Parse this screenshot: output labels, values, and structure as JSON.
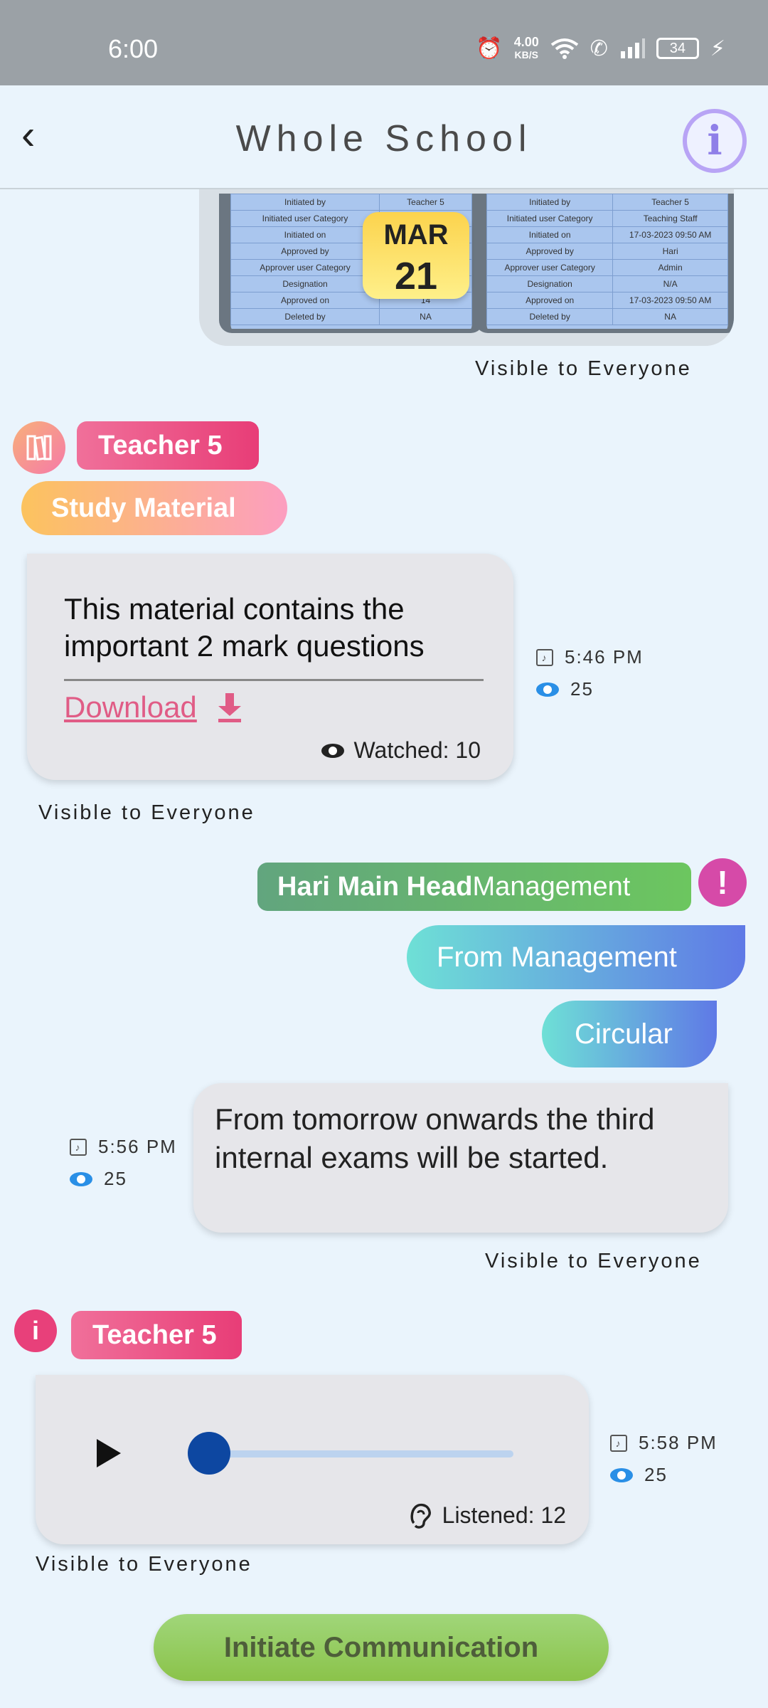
{
  "status_bar": {
    "time": "6:00",
    "speed_value": "4.00",
    "speed_unit": "KB/S",
    "battery": "34"
  },
  "header": {
    "title": "Whole School"
  },
  "image_message": {
    "date_month": "MAR",
    "date_day": "21",
    "visibility": "Visible to Everyone",
    "sheet_left": [
      [
        "Initiated by",
        "Teacher 5"
      ],
      [
        "Initiated user Category",
        "Teaching Staff"
      ],
      [
        "Initiated on",
        "14"
      ],
      [
        "Approved by",
        ""
      ],
      [
        "Approver user Category",
        ""
      ],
      [
        "Designation",
        ""
      ],
      [
        "Approved on",
        "14"
      ],
      [
        "Deleted by",
        "NA"
      ]
    ],
    "sheet_right": [
      [
        "Initiated by",
        "Teacher 5"
      ],
      [
        "Initiated user Category",
        "Teaching Staff"
      ],
      [
        "Initiated on",
        "17-03-2023 09:50 AM"
      ],
      [
        "Approved by",
        "Hari"
      ],
      [
        "Approver user Category",
        "Admin"
      ],
      [
        "Designation",
        "N/A"
      ],
      [
        "Approved on",
        "17-03-2023 09:50 AM"
      ],
      [
        "Deleted by",
        "NA"
      ]
    ]
  },
  "msg1": {
    "sender": "Teacher 5",
    "category": "Study Material",
    "text": "This material contains the important 2 mark questions",
    "download_label": "Download",
    "watched": "Watched: 10",
    "time": "5:46 PM",
    "views": "25",
    "visibility": "Visible to Everyone"
  },
  "msg2": {
    "sender_bold": "Hari Main Head",
    "sender_role": "Management",
    "source": "From Management",
    "category": "Circular",
    "text": "From tomorrow onwards the third internal exams will be started.",
    "time": "5:56 PM",
    "views": "25",
    "visibility": "Visible to Everyone"
  },
  "msg3": {
    "sender": "Teacher 5",
    "listened": "Listened: 12",
    "time": "5:58 PM",
    "views": "25",
    "visibility": "Visible to Everyone",
    "progress": 0.04
  },
  "cta": {
    "label": "Initiate Communication"
  },
  "colors": {
    "accent": "#2a8fe6",
    "seek": "#0d47a1",
    "cta": "#8bc34a"
  }
}
